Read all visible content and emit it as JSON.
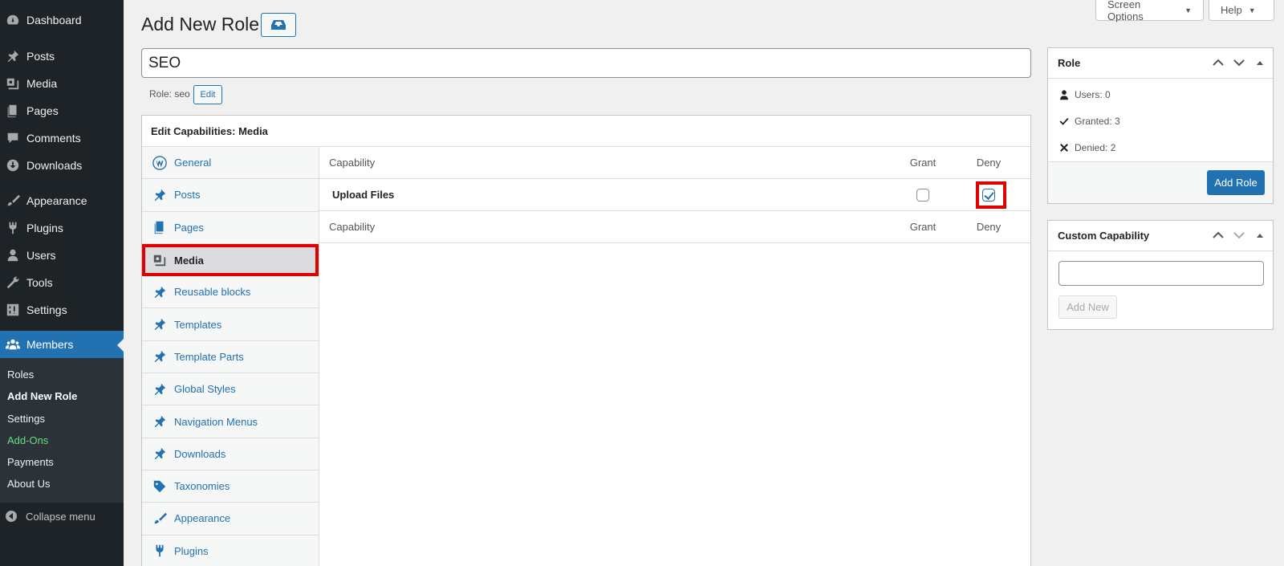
{
  "menu": {
    "items": [
      {
        "label": "Dashboard",
        "icon": "dashboard-icon"
      },
      {
        "label": "Posts",
        "icon": "pin-icon"
      },
      {
        "label": "Media",
        "icon": "media-icon"
      },
      {
        "label": "Pages",
        "icon": "pages-icon"
      },
      {
        "label": "Comments",
        "icon": "comments-icon"
      },
      {
        "label": "Downloads",
        "icon": "download-icon"
      },
      {
        "label": "Appearance",
        "icon": "brush-icon"
      },
      {
        "label": "Plugins",
        "icon": "plugin-icon"
      },
      {
        "label": "Users",
        "icon": "user-icon"
      },
      {
        "label": "Tools",
        "icon": "wrench-icon"
      },
      {
        "label": "Settings",
        "icon": "settings-icon"
      },
      {
        "label": "Members",
        "icon": "members-icon"
      }
    ],
    "submenu": [
      {
        "label": "Roles"
      },
      {
        "label": "Add New Role"
      },
      {
        "label": "Settings"
      },
      {
        "label": "Add-Ons"
      },
      {
        "label": "Payments"
      },
      {
        "label": "About Us"
      }
    ],
    "collapse_label": "Collapse menu"
  },
  "header": {
    "screen_options": "Screen Options",
    "help": "Help",
    "title": "Add New Role"
  },
  "role": {
    "name_value": "SEO",
    "slug_label": "Role: seo",
    "edit_label": "Edit"
  },
  "caps": {
    "heading": "Edit Capabilities: Media",
    "tabs": [
      {
        "label": "General",
        "icon": "wordpress-icon"
      },
      {
        "label": "Posts",
        "icon": "pin-icon"
      },
      {
        "label": "Pages",
        "icon": "pages-icon"
      },
      {
        "label": "Media",
        "icon": "media-icon"
      },
      {
        "label": "Reusable blocks",
        "icon": "pin-icon"
      },
      {
        "label": "Templates",
        "icon": "pin-icon"
      },
      {
        "label": "Template Parts",
        "icon": "pin-icon"
      },
      {
        "label": "Global Styles",
        "icon": "pin-icon"
      },
      {
        "label": "Navigation Menus",
        "icon": "pin-icon"
      },
      {
        "label": "Downloads",
        "icon": "pin-icon"
      },
      {
        "label": "Taxonomies",
        "icon": "tag-icon"
      },
      {
        "label": "Appearance",
        "icon": "brush-icon"
      },
      {
        "label": "Plugins",
        "icon": "plugin-icon"
      }
    ],
    "col_capability": "Capability",
    "col_grant": "Grant",
    "col_deny": "Deny",
    "rows": [
      {
        "name": "Upload Files",
        "grant": false,
        "deny": true
      }
    ]
  },
  "role_box": {
    "title": "Role",
    "users": "Users: 0",
    "granted": "Granted: 3",
    "denied": "Denied: 2",
    "add_role": "Add Role"
  },
  "custom_cap": {
    "title": "Custom Capability",
    "input_value": "",
    "add_new": "Add New"
  },
  "colors": {
    "accent": "#2271b1",
    "highlight": "#e00000",
    "sidebar": "#1d2327"
  }
}
